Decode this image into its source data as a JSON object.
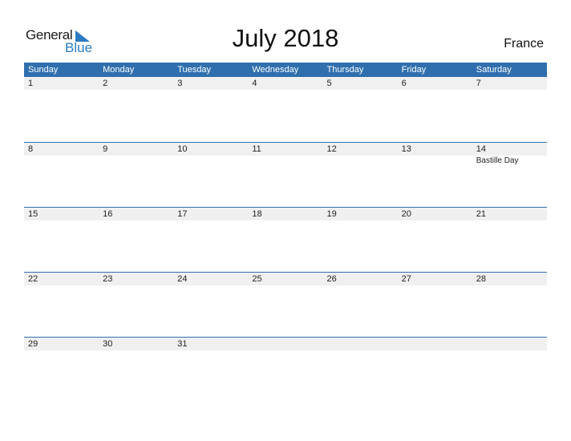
{
  "logo": {
    "line1": "General",
    "line2": "Blue",
    "brand_color": "#2a7bc4"
  },
  "header": {
    "title": "July 2018",
    "country": "France"
  },
  "colors": {
    "header_bg": "#2f6fad",
    "date_band_bg": "#f0f0f0"
  },
  "weekdays": [
    "Sunday",
    "Monday",
    "Tuesday",
    "Wednesday",
    "Thursday",
    "Friday",
    "Saturday"
  ],
  "weeks": [
    {
      "days": [
        "1",
        "2",
        "3",
        "4",
        "5",
        "6",
        "7"
      ],
      "events": [
        "",
        "",
        "",
        "",
        "",
        "",
        ""
      ]
    },
    {
      "days": [
        "8",
        "9",
        "10",
        "11",
        "12",
        "13",
        "14"
      ],
      "events": [
        "",
        "",
        "",
        "",
        "",
        "",
        "Bastille Day"
      ]
    },
    {
      "days": [
        "15",
        "16",
        "17",
        "18",
        "19",
        "20",
        "21"
      ],
      "events": [
        "",
        "",
        "",
        "",
        "",
        "",
        ""
      ]
    },
    {
      "days": [
        "22",
        "23",
        "24",
        "25",
        "26",
        "27",
        "28"
      ],
      "events": [
        "",
        "",
        "",
        "",
        "",
        "",
        ""
      ]
    },
    {
      "days": [
        "29",
        "30",
        "31",
        "",
        "",
        "",
        ""
      ],
      "events": [
        "",
        "",
        "",
        "",
        "",
        "",
        ""
      ]
    }
  ]
}
